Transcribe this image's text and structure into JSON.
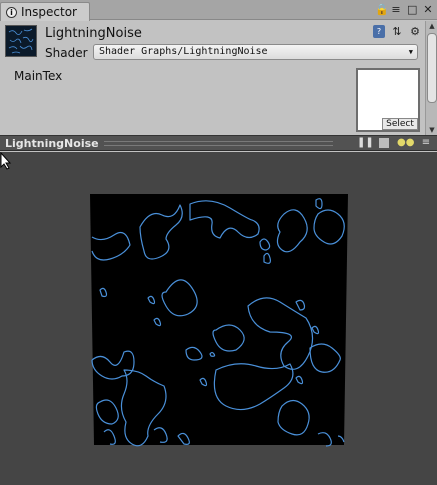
{
  "tab": {
    "label": "Inspector",
    "icon": "info-icon"
  },
  "window_controls": [
    "lock-icon",
    "menu-icon",
    "maximize-icon",
    "close-icon"
  ],
  "material": {
    "name": "LightningNoise",
    "shader_label": "Shader",
    "shader_value": "Shader Graphs/LightningNoise"
  },
  "header_icons": [
    "help-book-icon",
    "settings-sliders-icon",
    "gear-icon"
  ],
  "properties": [
    {
      "label": "MainTex",
      "select_label": "Select"
    }
  ],
  "preview": {
    "title": "LightningNoise",
    "controls": [
      "pause-icon",
      "plane-icon",
      "light-icon",
      "menu-icon"
    ],
    "background": "#454545",
    "noise_color": "#4a90d9"
  }
}
